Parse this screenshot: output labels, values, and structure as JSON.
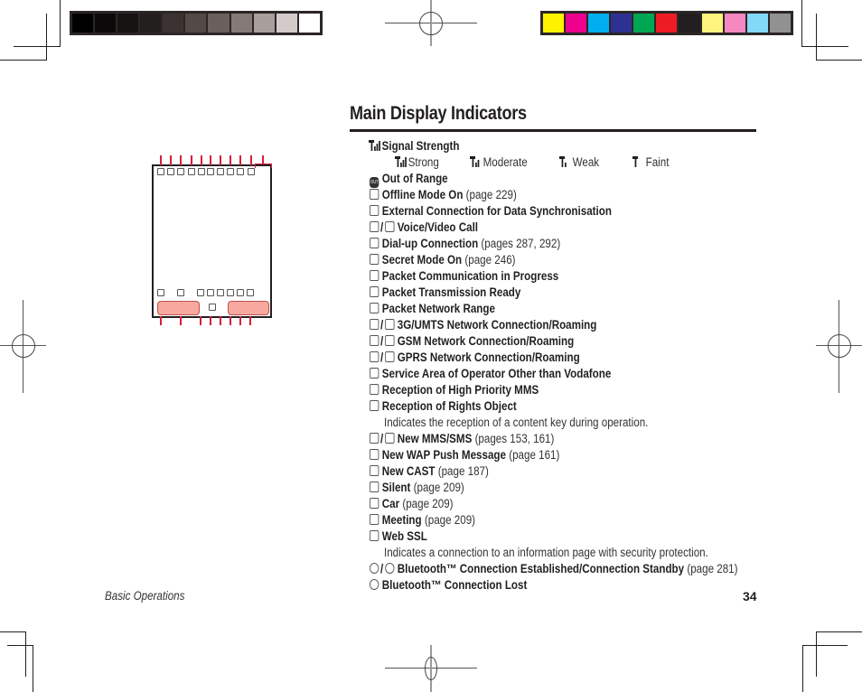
{
  "page": {
    "title": "Main Display Indicators",
    "footer_section": "Basic Operations",
    "page_number": "34"
  },
  "color_bars": {
    "grayscale": [
      "#000000",
      "#0b0909",
      "#161312",
      "#231f1d",
      "#3a3331",
      "#534946",
      "#6a5f5c",
      "#857a77",
      "#a89e9b",
      "#d3cbca",
      "#ffffff"
    ],
    "process": [
      "#fff200",
      "#ec008c",
      "#00aeef",
      "#2e3192",
      "#00a651",
      "#ed1c24",
      "#231f20",
      "#fff57c",
      "#f587c1",
      "#82d8f7",
      "#929191"
    ]
  },
  "signal": {
    "icon": "signal-strength-icon",
    "label": "Signal Strength",
    "levels": [
      {
        "icon": "signal-strong-icon",
        "label": "Strong",
        "bars": 3
      },
      {
        "icon": "signal-moderate-icon",
        "label": "Moderate",
        "bars": 2
      },
      {
        "icon": "signal-weak-icon",
        "label": "Weak",
        "bars": 1
      },
      {
        "icon": "signal-faint-icon",
        "label": "Faint",
        "bars": 0
      }
    ]
  },
  "entries": [
    {
      "icon": "out-of-range-icon",
      "label": "Out of Range",
      "ref": ""
    },
    {
      "icon": "offline-mode-icon",
      "label": "Offline Mode On",
      "ref": "(page 229)"
    },
    {
      "icon": "external-connection-icon",
      "label": "External Connection for Data Synchronisation",
      "ref": ""
    },
    {
      "icon": "voice-call-icon",
      "icon2": "video-call-icon",
      "label": "Voice/Video Call",
      "ref": ""
    },
    {
      "icon": "dial-up-icon",
      "label": "Dial-up Connection",
      "ref": "(pages 287, 292)"
    },
    {
      "icon": "secret-mode-icon",
      "label": "Secret Mode On",
      "ref": "(page 246)"
    },
    {
      "icon": "packet-communication-icon",
      "label": "Packet Communication in Progress",
      "ref": ""
    },
    {
      "icon": "packet-ready-icon",
      "label": "Packet Transmission Ready",
      "ref": ""
    },
    {
      "icon": "packet-network-icon",
      "label": "Packet Network Range",
      "ref": ""
    },
    {
      "icon": "3g-network-icon",
      "icon2": "3g-roaming-icon",
      "label": "3G/UMTS Network Connection/Roaming",
      "ref": ""
    },
    {
      "icon": "gsm-network-icon",
      "icon2": "gsm-roaming-icon",
      "label": "GSM Network Connection/Roaming",
      "ref": ""
    },
    {
      "icon": "gprs-network-icon",
      "icon2": "gprs-roaming-icon",
      "label": "GPRS Network Connection/Roaming",
      "ref": ""
    },
    {
      "icon": "other-operator-icon",
      "label": "Service Area of Operator Other than Vodafone",
      "ref": ""
    },
    {
      "icon": "high-priority-mms-icon",
      "label": "Reception of High Priority MMS",
      "ref": ""
    },
    {
      "icon": "rights-object-icon",
      "label": "Reception of Rights Object",
      "ref": "",
      "desc": "Indicates the reception of a content key during operation."
    },
    {
      "icon": "new-mms-icon",
      "icon2": "new-sms-icon",
      "label": "New MMS/SMS",
      "ref": "(pages 153, 161)"
    },
    {
      "icon": "wap-push-icon",
      "label": "New WAP Push Message",
      "ref": "(page 161)"
    },
    {
      "icon": "new-cast-icon",
      "label": "New CAST",
      "ref": "(page 187)"
    },
    {
      "icon": "silent-icon",
      "label": "Silent",
      "ref": "(page 209)"
    },
    {
      "icon": "car-icon",
      "label": "Car",
      "ref": "(page 209)"
    },
    {
      "icon": "meeting-icon",
      "label": "Meeting",
      "ref": "(page 209)"
    },
    {
      "icon": "web-ssl-icon",
      "label": "Web SSL",
      "ref": "",
      "desc": "Indicates a connection to an information page with security protection."
    },
    {
      "icon": "bluetooth-established-icon",
      "icon2": "bluetooth-standby-icon",
      "label": "Bluetooth™ Connection Established/Connection Standby",
      "ref": "(page 281)"
    },
    {
      "icon": "bluetooth-lost-icon",
      "label": "Bluetooth™ Connection Lost",
      "ref": ""
    }
  ],
  "out_icon_text": "OUT"
}
